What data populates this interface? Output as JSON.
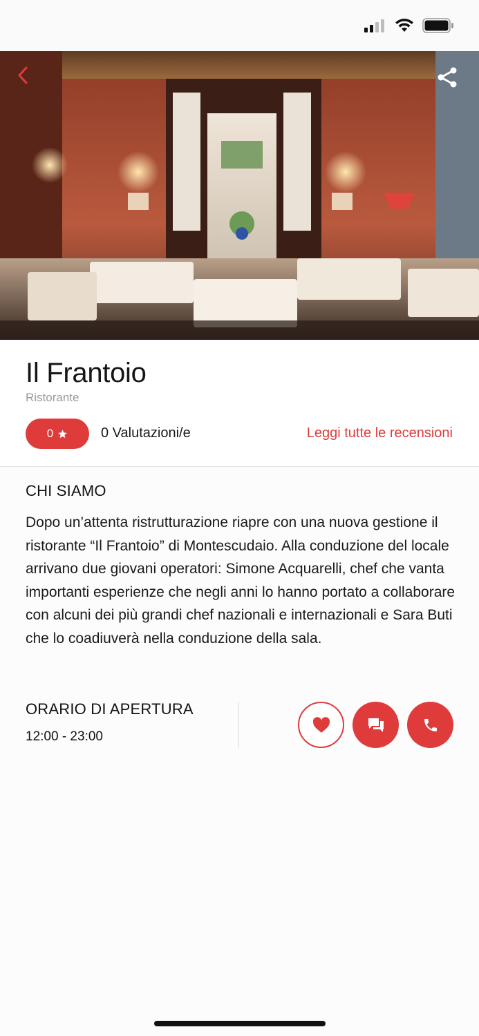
{
  "status_bar": {
    "icons": [
      "cellular-signal-icon",
      "wifi-icon",
      "battery-icon"
    ]
  },
  "hero": {
    "back_icon": "chevron-left-icon",
    "share_icon": "share-icon"
  },
  "restaurant": {
    "name": "Il Frantoio",
    "category": "Ristorante",
    "rating_value": "0",
    "rating_icon": "star-icon",
    "ratings_count_label": "0 Valutazioni/e",
    "read_reviews_label": "Leggi tutte le recensioni"
  },
  "about": {
    "heading": "CHI SIAMO",
    "text": "Dopo un’attenta ristrutturazione riapre con una nuova gestione il ristorante “Il Frantoio” di Montescudaio. Alla conduzione del locale arrivano due giovani operatori: Simone Acquarelli, chef che vanta importanti esperienze che negli anni lo hanno portato a collaborare con alcuni dei più grandi chef nazionali e internazionali e Sara Buti che lo coadiuverà nella conduzione della sala."
  },
  "hours": {
    "heading": "ORARIO DI APERTURA",
    "value": "12:00 - 23:00"
  },
  "actions": [
    {
      "name": "favorite-button",
      "icon": "heart-icon"
    },
    {
      "name": "chat-button",
      "icon": "chat-icon"
    },
    {
      "name": "call-button",
      "icon": "phone-icon"
    }
  ],
  "colors": {
    "accent": "#df3b3b",
    "text": "#1a1a1a",
    "muted": "#9a9a9a",
    "background": "#fcfcfc"
  }
}
